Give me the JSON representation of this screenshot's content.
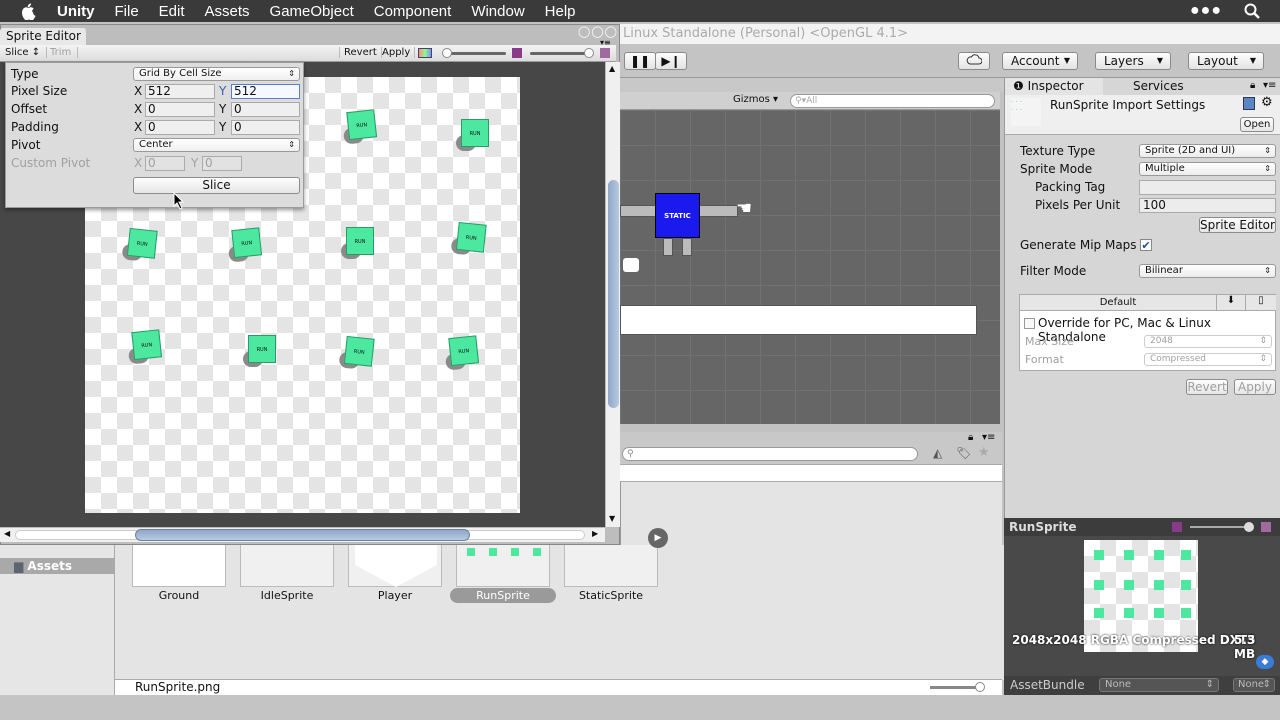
{
  "menubar": {
    "app": "Unity",
    "items": [
      "File",
      "Edit",
      "Assets",
      "GameObject",
      "Component",
      "Window",
      "Help"
    ]
  },
  "window_title": "Linux Standalone (Personal) <OpenGL 4.1>",
  "toolbar": {
    "account": "Account",
    "layers": "Layers",
    "layout": "Layout"
  },
  "sprite_editor": {
    "tab": "Sprite Editor",
    "slice_menu": "Slice ↕",
    "trim": "Trim",
    "revert": "Revert",
    "apply": "Apply",
    "slice_popup": {
      "type_label": "Type",
      "type_value": "Grid By Cell Size",
      "pixel_size_label": "Pixel Size",
      "pixel_size_x": "512",
      "pixel_size_y": "512",
      "offset_label": "Offset",
      "offset_x": "0",
      "offset_y": "0",
      "padding_label": "Padding",
      "padding_x": "0",
      "padding_y": "0",
      "pivot_label": "Pivot",
      "pivot_value": "Center",
      "custom_pivot_label": "Custom Pivot",
      "custom_pivot_x": "0",
      "custom_pivot_y": "0",
      "x": "X",
      "y": "Y",
      "slice_button": "Slice"
    },
    "sprite_label": "RUN"
  },
  "scene": {
    "gizmos": "Gizmos",
    "search_placeholder": "All",
    "player_label": "STATIC"
  },
  "inspector": {
    "tab": "Inspector",
    "services_tab": "Services",
    "title": "RunSprite Import Settings",
    "open": "Open",
    "texture_type_label": "Texture Type",
    "texture_type": "Sprite (2D and UI)",
    "sprite_mode_label": "Sprite Mode",
    "sprite_mode": "Multiple",
    "packing_tag_label": "Packing Tag",
    "packing_tag": "",
    "ppu_label": "Pixels Per Unit",
    "ppu": "100",
    "sprite_editor_button": "Sprite Editor",
    "mipmaps_label": "Generate Mip Maps",
    "mipmaps_checked": true,
    "filter_label": "Filter Mode",
    "filter": "Bilinear",
    "platform_default": "Default",
    "override_label": "Override for PC, Mac & Linux Standalone",
    "max_size_label": "Max Size",
    "max_size": "2048",
    "format_label": "Format",
    "format": "Compressed",
    "revert": "Revert",
    "apply": "Apply"
  },
  "preview": {
    "title": "RunSprite",
    "info": "2048x2048  RGBA Compressed DXT5",
    "size": "5.3 MB",
    "assetbundle_label": "AssetBundle",
    "bundle_name": "None",
    "bundle_variant": "None"
  },
  "project": {
    "folder": "Assets",
    "assets": [
      "Ground",
      "IdleSprite",
      "Player",
      "RunSprite",
      "StaticSprite"
    ],
    "selected": "RunSprite",
    "path": "RunSprite.png"
  }
}
